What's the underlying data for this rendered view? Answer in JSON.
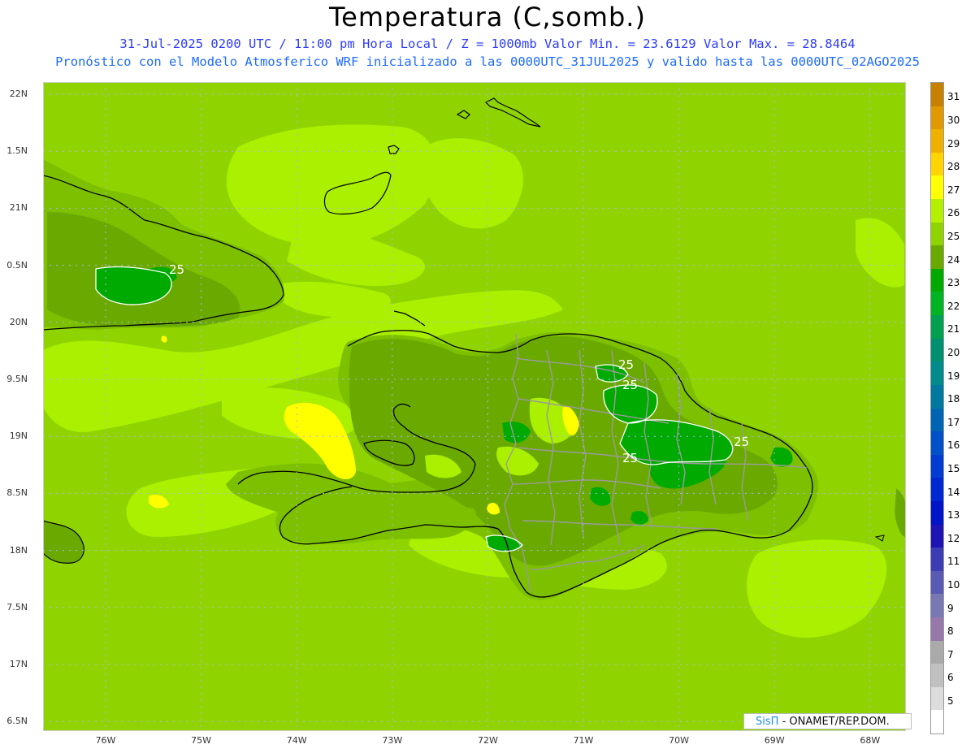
{
  "header": {
    "title": "Temperatura (C,somb.)",
    "subtitle_line1": "31-Jul-2025  0200 UTC / 11:00 pm Hora Local / Z = 1000mb  Valor Min. = 23.6129  Valor Max. = 28.8464",
    "subtitle_line2": "Pronóstico con el Modelo Atmosferico WRF inicializado a las 0000UTC_31JUL2025 y valido hasta las  0000UTC_02AGO2025"
  },
  "map": {
    "lat_labels": [
      "22N",
      "1.5N",
      "21N",
      "0.5N",
      "20N",
      "9.5N",
      "19N",
      "8.5N",
      "18N",
      "7.5N",
      "17N",
      "6.5N"
    ],
    "lon_labels": [
      "76W",
      "75W",
      "74W",
      "73W",
      "72W",
      "71W",
      "70W",
      "69W",
      "68W"
    ],
    "contour_label": "25",
    "colors": {
      "base": "#8fd400",
      "warm": "#aaf000",
      "hot": "#ffff00",
      "cool": "#6bb000",
      "cooler": "#00aa00",
      "coast": "#000000",
      "borders": "#9a9a9a"
    }
  },
  "colorbar": {
    "levels": [
      "31",
      "30",
      "29",
      "28",
      "27",
      "26",
      "25",
      "24",
      "23",
      "22",
      "21",
      "20",
      "19",
      "18",
      "17",
      "16",
      "15",
      "14",
      "13",
      "12",
      "11",
      "10",
      "9",
      "8",
      "7",
      "6",
      "5"
    ],
    "colors": [
      "#c88000",
      "#e09a00",
      "#f0b000",
      "#ffd400",
      "#ffff00",
      "#b4f000",
      "#8fd400",
      "#6aaa00",
      "#00aa00",
      "#00b424",
      "#00a050",
      "#009070",
      "#008c8c",
      "#0078a0",
      "#0064b4",
      "#0050c8",
      "#003cd2",
      "#0028d2",
      "#0014c8",
      "#1e14b4",
      "#3c3cb4",
      "#5a5ab4",
      "#7878b4",
      "#9678aa",
      "#aaaaaa",
      "#c0c0c0",
      "#dcdcdc",
      "#ffffff"
    ]
  },
  "credit": {
    "brand": "SisΠ",
    "rest": "- ONAMET/REP.DOM."
  }
}
